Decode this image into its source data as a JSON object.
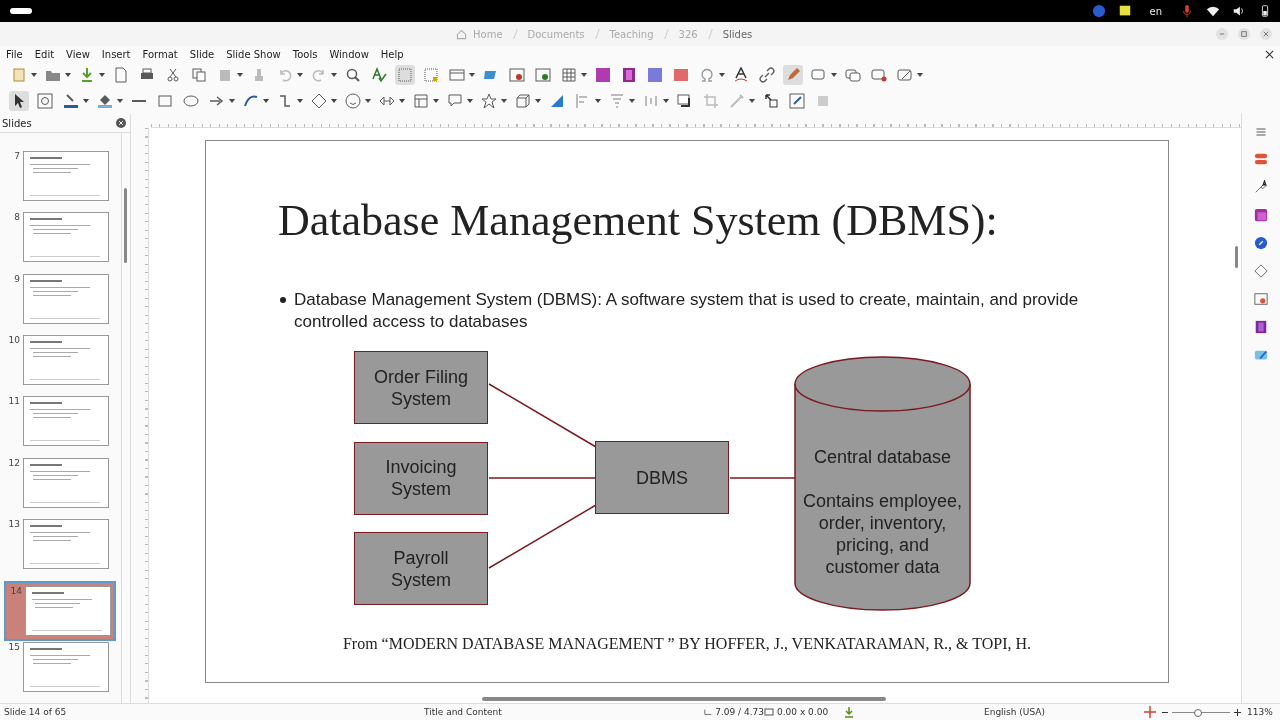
{
  "system_bar": {
    "language": "en"
  },
  "window": {
    "breadcrumb": [
      "Home",
      "Documents",
      "Teaching",
      "326",
      "Slides"
    ]
  },
  "menu": [
    "File",
    "Edit",
    "View",
    "Insert",
    "Format",
    "Slide",
    "Slide Show",
    "Tools",
    "Window",
    "Help"
  ],
  "slides_panel": {
    "title": "Slides",
    "slides": [
      {
        "number": "7",
        "selected": false
      },
      {
        "number": "8",
        "selected": false
      },
      {
        "number": "9",
        "selected": false
      },
      {
        "number": "10",
        "selected": false
      },
      {
        "number": "11",
        "selected": false
      },
      {
        "number": "12",
        "selected": false
      },
      {
        "number": "13",
        "selected": false
      },
      {
        "number": "14",
        "selected": true
      },
      {
        "number": "15",
        "selected": false
      }
    ]
  },
  "slide": {
    "title": "Database Management System (DBMS):",
    "bullets": [
      "Database Management System (DBMS): A software system that is used to create, maintain, and provide controlled access to databases"
    ],
    "diagram": {
      "sources": [
        {
          "label": "Order Filing System"
        },
        {
          "label": "Invoicing System"
        },
        {
          "label": "Payroll System"
        }
      ],
      "hub": "DBMS",
      "store": {
        "title": "Central database",
        "description": "Contains employee, order, inventory, pricing, and customer data"
      }
    },
    "citation": "From “MODERN DATABASE MANAGEMENT ” BY HOFFER, J., VENKATARAMAN, R., & TOPI, H."
  },
  "status_bar": {
    "slide": "Slide 14 of 65",
    "layout": "Title and Content",
    "position": "7.09 / 4.73",
    "size": "0.00 x 0.00",
    "language": "English (USA)",
    "zoom_slider": {
      "level": 0.45
    },
    "zoom": "113%"
  }
}
